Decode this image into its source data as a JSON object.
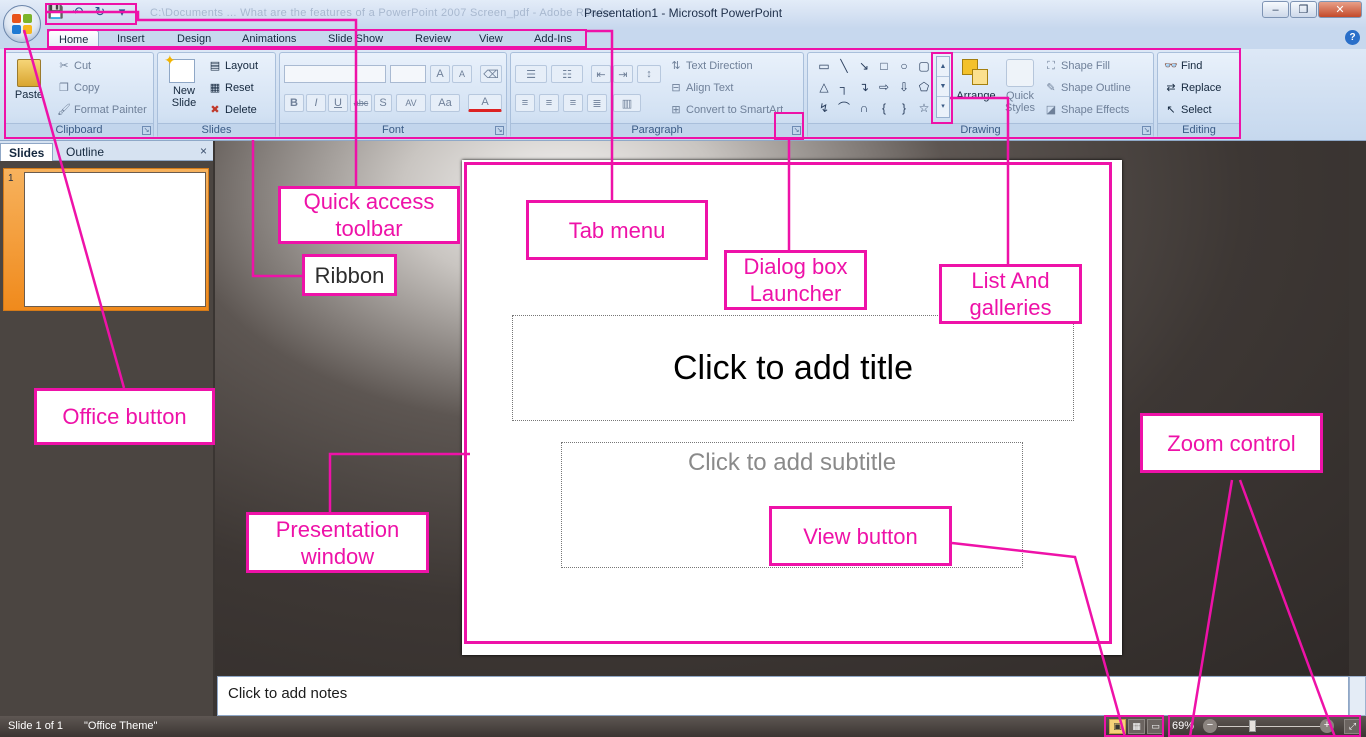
{
  "window": {
    "title": "Presentation1 - Microsoft PowerPoint",
    "blurred_path": "C:\\Documents ... What are the features of a PowerPoint 2007 Screen_pdf - Adobe Reader",
    "controls": {
      "minimize": "–",
      "maximize": "❐",
      "close": "✕"
    }
  },
  "qat": {
    "save": "💾",
    "undo": "↶",
    "redo": "↻",
    "more": "▾"
  },
  "tabs": [
    "Home",
    "Insert",
    "Design",
    "Animations",
    "Slide Show",
    "Review",
    "View",
    "Add-Ins"
  ],
  "active_tab": "Home",
  "help": "?",
  "ribbon": {
    "clipboard": {
      "label": "Clipboard",
      "paste": "Paste",
      "cut": "Cut",
      "copy": "Copy",
      "format_painter": "Format Painter"
    },
    "slides": {
      "label": "Slides",
      "new_slide": "New Slide",
      "layout": "Layout",
      "reset": "Reset",
      "delete": "Delete"
    },
    "font": {
      "label": "Font",
      "bold": "B",
      "italic": "I",
      "underline": "U",
      "strike": "abc",
      "shadow": "S",
      "spacing": "AV",
      "case": "Aa",
      "color": "A",
      "grow": "A",
      "shrink": "A"
    },
    "paragraph": {
      "label": "Paragraph",
      "text_direction": "Text Direction",
      "align_text": "Align Text",
      "convert": "Convert to SmartArt"
    },
    "drawing": {
      "label": "Drawing",
      "arrange": "Arrange",
      "quick_styles": "Quick Styles",
      "shape_fill": "Shape Fill",
      "shape_outline": "Shape Outline",
      "shape_effects": "Shape Effects"
    },
    "editing": {
      "label": "Editing",
      "find": "Find",
      "replace": "Replace",
      "select": "Select"
    }
  },
  "pane": {
    "slides_tab": "Slides",
    "outline_tab": "Outline",
    "close": "×",
    "thumb_number": "1"
  },
  "slide": {
    "title_placeholder": "Click to add title",
    "subtitle_placeholder": "Click to add subtitle"
  },
  "notes": {
    "placeholder": "Click to add notes"
  },
  "status": {
    "slide_count": "Slide 1 of 1",
    "theme": "\"Office Theme\"",
    "zoom": "69%"
  },
  "annotations": {
    "quick_access": "Quick access toolbar",
    "ribbon": "Ribbon",
    "tab_menu": "Tab menu",
    "dialog_launcher": "Dialog box Launcher",
    "list_galleries": "List And galleries",
    "office_button": "Office  button",
    "presentation_window": "Presentation window",
    "view_button": "View button",
    "zoom_control": "Zoom control"
  },
  "colors": {
    "annotation": "#ee12a8",
    "ribbon_bg": "#d2e1f3",
    "thumb_selected": "#f08a1c"
  }
}
